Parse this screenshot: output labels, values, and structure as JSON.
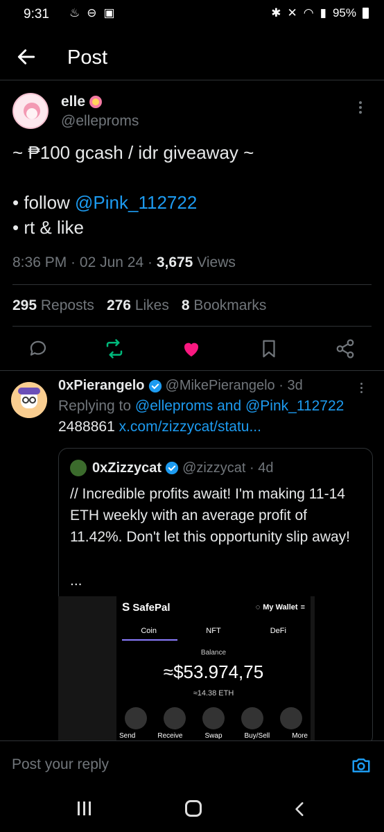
{
  "status": {
    "time": "9:31",
    "battery": "95%"
  },
  "header": {
    "title": "Post"
  },
  "post": {
    "name": "elle",
    "handle": "@elleproms",
    "line1": "~ ₱100 gcash / idr giveaway ~",
    "line2_prefix": "• follow ",
    "line2_link": "@Pink_112722",
    "line3": "• rt & like",
    "time": "8:36 PM",
    "date": "02 Jun 24",
    "views_count": "3,675",
    "views_label": "Views",
    "reposts_count": "295",
    "reposts_label": "Reposts",
    "likes_count": "276",
    "likes_label": "Likes",
    "bookmarks_count": "8",
    "bookmarks_label": "Bookmarks"
  },
  "reply": {
    "name": "0xPierangelo",
    "handle": "@MikePierangelo",
    "age": "3d",
    "replying_prefix": "Replying to ",
    "replying_1": "@elleproms",
    "replying_and": " and ",
    "replying_2": "@Pink_112722",
    "text_prefix": "2488861 ",
    "text_link": "x.com/zizzycat/statu...",
    "quote": {
      "name": "0xZizzycat",
      "handle": "@zizzycat",
      "age": "4d",
      "text": "// Incredible profits await! I'm making 11-14 ETH weekly with an average profit of 11.42%. Don't let this opportunity slip away!",
      "ellipsis": "...",
      "wallet": {
        "brand": "SafePal",
        "wallet_label": "My Wallet",
        "tabs": [
          "Coin",
          "NFT",
          "DeFi"
        ],
        "balance_label": "Balance",
        "balance": "≈$53.974,75",
        "eth": "≈14.38 ETH",
        "actions": [
          "Send",
          "Receive",
          "Swap",
          "Buy/Sell",
          "More"
        ]
      }
    }
  },
  "compose": {
    "placeholder": "Post your reply"
  },
  "colors": {
    "accent": "#1d9bf0",
    "like": "#f91880",
    "repost": "#00ba7c"
  }
}
